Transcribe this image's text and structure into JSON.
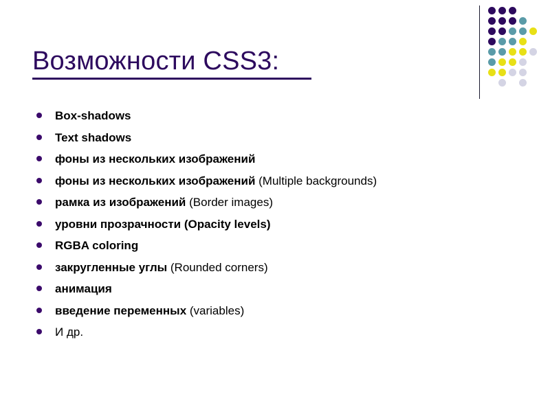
{
  "slide": {
    "title": "Возможности CSS3:",
    "background_color": "#ffffff",
    "title_color": "#2d0a5e",
    "bullet_color": "#3b0a6b",
    "text_color": "#000000"
  },
  "bullets": [
    {
      "strong": "Box-shadows",
      "plain": ""
    },
    {
      "strong": "Text shadows",
      "plain": ""
    },
    {
      "strong": "фоны из нескольких изображений",
      "plain": ""
    },
    {
      "strong": "фоны из нескольких изображений",
      "plain": " (Multiple backgrounds)"
    },
    {
      "strong": "рамка из изображений",
      "plain": " (Border images)"
    },
    {
      "strong": "уровни прозрачности (Opacity levels)",
      "plain": ""
    },
    {
      "strong": "RGBA coloring",
      "plain": ""
    },
    {
      "strong": "закругленные углы",
      "plain": " (Rounded corners)"
    },
    {
      "strong": "анимация",
      "plain": ""
    },
    {
      "strong": "введение переменных",
      "plain": " (variables)"
    },
    {
      "strong": "",
      "plain": "И др."
    }
  ],
  "decoration": {
    "name": "dot-grid",
    "rule_color": "#1a1a2e",
    "palette": {
      "purple": "#2d0a5e",
      "teal": "#5a9ba8",
      "yellow": "#e8e016",
      "lavender": "#d4d4e4"
    },
    "dot_spacing": 15,
    "dot_size": 11,
    "rows": [
      [
        "purple",
        "purple",
        "purple",
        null,
        null
      ],
      [
        "purple",
        "purple",
        "purple",
        "teal",
        null
      ],
      [
        "purple",
        "purple",
        "teal",
        "teal",
        "yellow"
      ],
      [
        "purple",
        "teal",
        "teal",
        "yellow",
        null
      ],
      [
        "teal",
        "teal",
        "yellow",
        "yellow",
        "lavender"
      ],
      [
        "teal",
        "yellow",
        "yellow",
        "lavender",
        null
      ],
      [
        "yellow",
        "yellow",
        "lavender",
        "lavender",
        null
      ],
      [
        null,
        "lavender",
        null,
        "lavender",
        null
      ]
    ]
  }
}
